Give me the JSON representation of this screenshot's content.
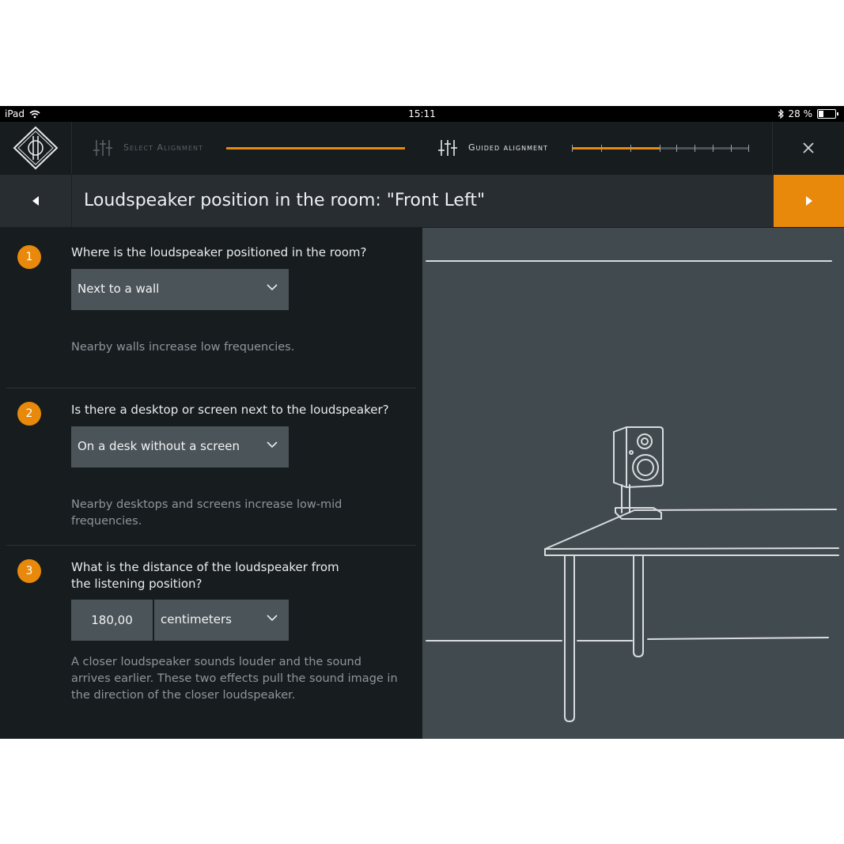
{
  "status_bar": {
    "device": "iPad",
    "time": "15:11",
    "battery": "28 %"
  },
  "nav": {
    "step1_label": "Select Alignment",
    "step1_progress": 1.0,
    "step2_label": "Guided alignment",
    "step2_progress": 0.5
  },
  "title_bar": {
    "title": "Loudspeaker position in the room:  \"Front Left\""
  },
  "questions": [
    {
      "number": "1",
      "text": "Where is the loudspeaker positioned in the room?",
      "selected": "Next to a wall",
      "hint": "Nearby walls increase low frequencies."
    },
    {
      "number": "2",
      "text": "Is there a desktop or screen next to the loudspeaker?",
      "selected": "On a desk without a screen",
      "hint": "Nearby desktops and screens increase low-mid frequencies."
    },
    {
      "number": "3",
      "text": "What is the distance of the loudspeaker from the listening position?",
      "distance_value": "180,00",
      "unit": "centimeters",
      "hint": "A closer loudspeaker sounds louder and the sound arrives earlier. These two effects pull the sound image in the direction of the closer loudspeaker."
    }
  ],
  "colors": {
    "accent": "#e8890c",
    "background": "#171c1f",
    "panel": "#414a4f",
    "field": "#4b5459"
  }
}
